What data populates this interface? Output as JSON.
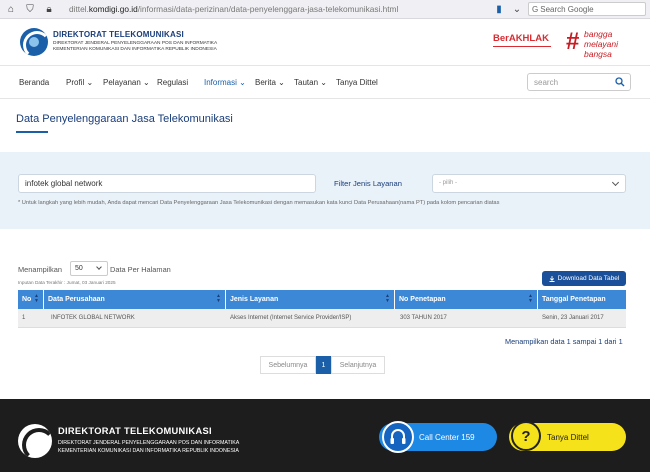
{
  "browser": {
    "url_prefix": "dittel.",
    "url_domain": "komdigi.go.id",
    "url_path": "/informasi/data-perizinan/data-penyelenggara-jasa-telekomunikasi.html",
    "search_placeholder": "Search Google"
  },
  "header": {
    "org_name": "DIREKTORAT TELEKOMUNIKASI",
    "org_sub": "DIREKTORAT JENDERAL PENYELENGGARAAN POS DAN INFORMATIKA KEMENTERIAN KOMUNIKASI DAN INFORMATIKA REPUBLIK INDONESIA",
    "berakhlak": "BerAKHLAK",
    "bangga_line1": "bangga",
    "bangga_line2": "melayani",
    "bangga_line3": "bangsa"
  },
  "nav": {
    "items": [
      "Beranda",
      "Profil",
      "Pelayanan",
      "Regulasi",
      "Informasi",
      "Berita",
      "Tautan",
      "Tanya Dittel"
    ],
    "search_placeholder": "search"
  },
  "page": {
    "title": "Data Penyelenggaraan Jasa Telekomunikasi"
  },
  "filter": {
    "search_value": "infotek global network",
    "jenis_label": "Filter Jenis Layanan",
    "jenis_value": "- pilih -",
    "hint": "* Untuk langkah yang lebih mudah, Anda dapat mencari Data Penyelenggaraan Jasa Telekomunikasi dengan memasukan kata kunci Data Perusahaan(nama PT) pada kolom pencarian diatas"
  },
  "table": {
    "menampilkan": "Menampilkan",
    "per_page": "50",
    "per_halaman": "Data Per Halaman",
    "inputan": "Inputan Data Terakhir : Jumat, 03 Januari 2025",
    "download": "Download Data Tabel",
    "headers": [
      "No",
      "Data Perusahaan",
      "Jenis Layanan",
      "No Penetapan",
      "Tanggal Penetapan"
    ],
    "rows": [
      [
        "1",
        "INFOTEK GLOBAL NETWORK",
        "Akses Internet (Internet Service Provider/ISP)",
        "303 TAHUN 2017",
        "Senin, 23 Januari 2017"
      ]
    ],
    "showing": "Menampilkan data 1 sampai 1 dari 1"
  },
  "pagination": {
    "prev": "Sebelumnya",
    "current": "1",
    "next": "Selanjutnya"
  },
  "footer": {
    "org_name": "DIREKTORAT TELEKOMUNIKASI",
    "org_sub": "DIREKTORAT JENDERAL PENYELENGGARAAN POS DAN INFORMATIKA KEMENTERIAN KOMUNIKASI DAN INFORMATIKA REPUBLIK INDONESIA",
    "call_center": "Call Center 159",
    "tanya_dittel": "Tanya Dittel"
  }
}
